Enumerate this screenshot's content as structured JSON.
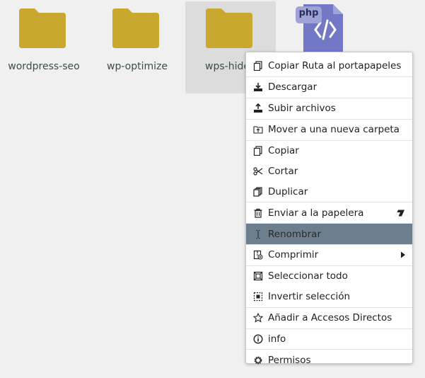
{
  "files": [
    {
      "name": "wordpress-seo",
      "type": "folder",
      "selected": false
    },
    {
      "name": "wp-optimize",
      "type": "folder",
      "selected": false
    },
    {
      "name": "wps-hide-l",
      "type": "folder",
      "selected": true
    },
    {
      "name": "",
      "type": "php",
      "badge": "php"
    }
  ],
  "colors": {
    "folder": "#c8a82e",
    "php_file": "#7378c6",
    "php_badge": "#9da2d8",
    "highlight": "#6d7f8f"
  },
  "context_menu": {
    "items": [
      {
        "label": "Copiar Ruta al portapapeles",
        "icon": "copy-icon"
      },
      {
        "label": "Descargar",
        "icon": "download-icon",
        "separator": true
      },
      {
        "label": "Subir archivos",
        "icon": "upload-icon",
        "separator": true
      },
      {
        "label": "Mover a una nueva carpeta",
        "icon": "move-folder-icon",
        "separator": true
      },
      {
        "label": "Copiar",
        "icon": "copy-icon",
        "separator": true
      },
      {
        "label": "Cortar",
        "icon": "scissors-icon"
      },
      {
        "label": "Duplicar",
        "icon": "duplicate-icon"
      },
      {
        "label": "Enviar a la papelera",
        "icon": "trash-icon",
        "separator": true,
        "shortcut_icon": "eraser-icon"
      },
      {
        "label": "Renombrar",
        "icon": "text-cursor-icon",
        "separator": true,
        "highlighted": true
      },
      {
        "label": "Comprimir",
        "icon": "archive-icon",
        "separator": true,
        "submenu": true
      },
      {
        "label": "Seleccionar todo",
        "icon": "select-all-icon",
        "separator": true
      },
      {
        "label": "Invertir selección",
        "icon": "invert-selection-icon"
      },
      {
        "label": "Añadir a Accesos Directos",
        "icon": "star-icon",
        "separator": true
      },
      {
        "label": "info",
        "icon": "info-icon",
        "separator": true
      },
      {
        "label": "Permisos",
        "icon": "gear-icon",
        "separator": true
      }
    ]
  }
}
